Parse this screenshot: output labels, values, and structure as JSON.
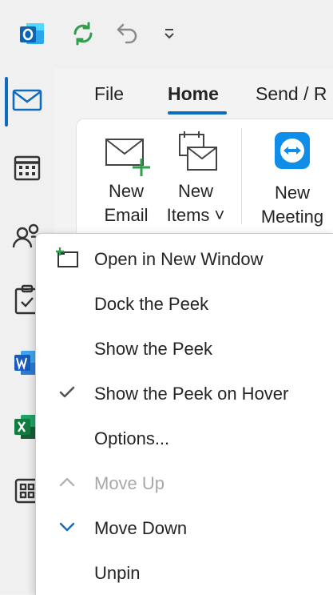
{
  "ribbon": {
    "tabs": [
      {
        "label": "File"
      },
      {
        "label": "Home"
      },
      {
        "label": "Send / R"
      }
    ],
    "active_tab": "Home",
    "buttons": {
      "new_email": {
        "line1": "New",
        "line2": "Email"
      },
      "new_items": {
        "line1": "New",
        "line2": "Items ˅"
      },
      "new_meeting": {
        "line1": "New",
        "line2": "Meeting"
      }
    }
  },
  "context_menu": {
    "items": [
      {
        "label": "Open in New Window",
        "icon": "open-new-window-icon",
        "enabled": true
      },
      {
        "label": "Dock the Peek",
        "icon": "",
        "enabled": true
      },
      {
        "label": "Show the Peek",
        "icon": "",
        "enabled": true
      },
      {
        "label": "Show the Peek on Hover",
        "icon": "checkmark-icon",
        "enabled": true,
        "checked": true
      },
      {
        "label": "Options...",
        "icon": "",
        "enabled": true
      },
      {
        "label": "Move Up",
        "icon": "chevron-up-icon",
        "enabled": false
      },
      {
        "label": "Move Down",
        "icon": "chevron-down-icon",
        "enabled": true
      },
      {
        "label": "Unpin",
        "icon": "",
        "enabled": true
      }
    ]
  },
  "left_nav": {
    "items": [
      "mail-icon",
      "calendar-icon",
      "people-icon",
      "tasks-icon",
      "word-icon",
      "excel-icon",
      "apps-icon"
    ],
    "active": "mail-icon"
  },
  "colors": {
    "accent": "#0f6cbd",
    "outlook_blue": "#0a64b4",
    "word_blue": "#185abd",
    "excel_green": "#107c41",
    "sync_green": "#2e9f4b",
    "teamviewer_blue": "#0e8ee9"
  }
}
